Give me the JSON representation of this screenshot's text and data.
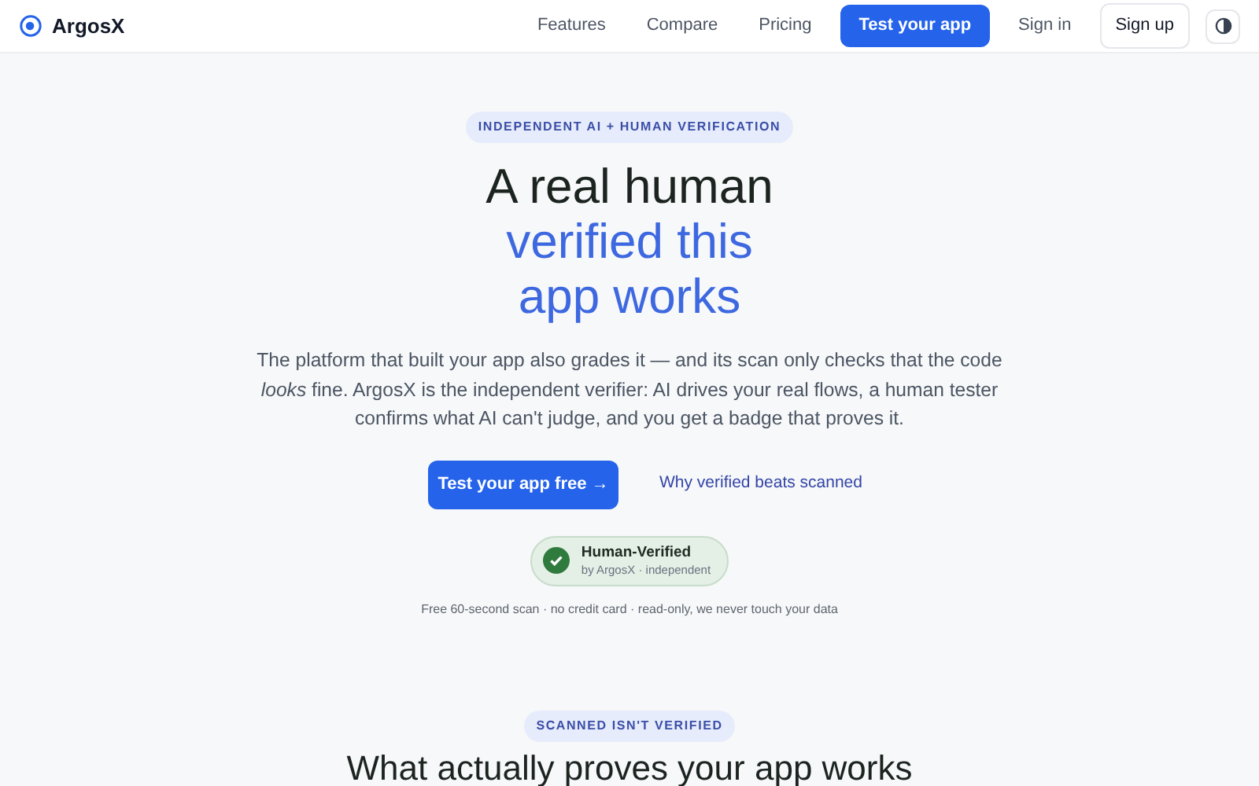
{
  "header": {
    "brand": "ArgosX",
    "nav": [
      {
        "label": "Features",
        "kind": "link"
      },
      {
        "label": "Compare",
        "kind": "link"
      },
      {
        "label": "Pricing",
        "kind": "link"
      },
      {
        "label": "Test your app",
        "kind": "primary"
      },
      {
        "label": "Sign in",
        "kind": "link"
      },
      {
        "label": "Sign up",
        "kind": "outline"
      }
    ]
  },
  "hero": {
    "eyebrow": "INDEPENDENT AI + HUMAN VERIFICATION",
    "headline": [
      {
        "text": "A real human",
        "kind": "plain"
      },
      {
        "text": "verified this",
        "kind": "accent"
      },
      {
        "text": "app works",
        "kind": "accent"
      }
    ],
    "description": "The platform that built your app also grades it — and its scan only checks that the code *looks* fine. ArgosX is the independent verifier: AI drives your real flows, a human tester confirms what AI can't judge, and you get a badge that proves it.",
    "primary_button": "Test your app free →",
    "secondary_link": "Why verified beats scanned",
    "badge": {
      "title": "Human-Verified",
      "subtitle": "by ArgosX · independent"
    },
    "footnote": "Free 60-second scan · no credit card · read-only, we never touch your data"
  },
  "section": {
    "eyebrow": "SCANNED ISN'T VERIFIED",
    "heading": "What actually proves your app works"
  }
}
